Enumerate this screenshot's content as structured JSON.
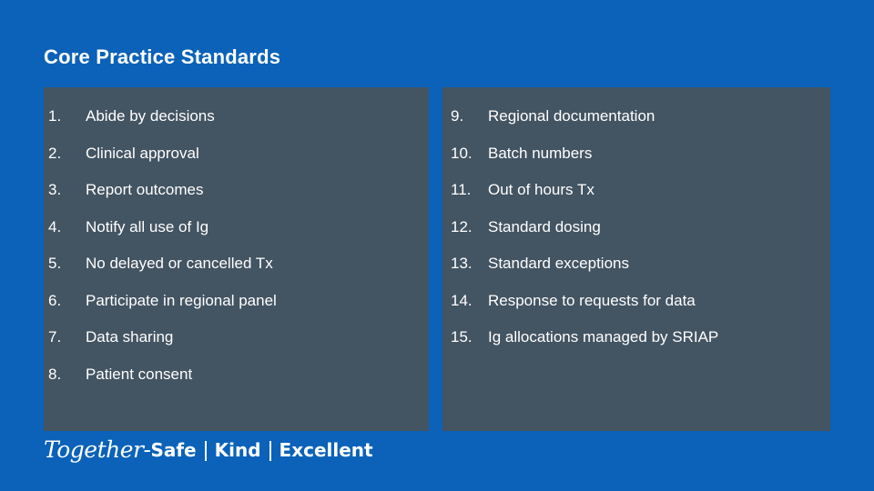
{
  "slide": {
    "title": "Core Practice Standards",
    "background_color": "#0b62b8",
    "panel_color": "#435462",
    "text_color": "#ffffff"
  },
  "columns": {
    "left": [
      {
        "num": "1.",
        "text": "Abide by decisions"
      },
      {
        "num": "2.",
        "text": "Clinical approval"
      },
      {
        "num": "3.",
        "text": "Report outcomes"
      },
      {
        "num": "4.",
        "text": "Notify all use of Ig"
      },
      {
        "num": "5.",
        "text": "No delayed or cancelled Tx"
      },
      {
        "num": "6.",
        "text": "Participate in regional panel"
      },
      {
        "num": "7.",
        "text": "Data sharing"
      },
      {
        "num": "8.",
        "text": "Patient consent"
      }
    ],
    "right": [
      {
        "num": "9.",
        "text": "Regional documentation"
      },
      {
        "num": "10.",
        "text": "Batch numbers"
      },
      {
        "num": "11.",
        "text": "Out of hours Tx"
      },
      {
        "num": "12.",
        "text": "Standard dosing"
      },
      {
        "num": "13.",
        "text": "Standard exceptions"
      },
      {
        "num": "14.",
        "text": "Response to requests for data"
      },
      {
        "num": "15.",
        "text": "Ig allocations managed by SRIAP"
      }
    ]
  },
  "footer": {
    "script_word": "Together-",
    "value_1": "Safe",
    "value_2": "Kind",
    "value_3": "Excellent"
  }
}
